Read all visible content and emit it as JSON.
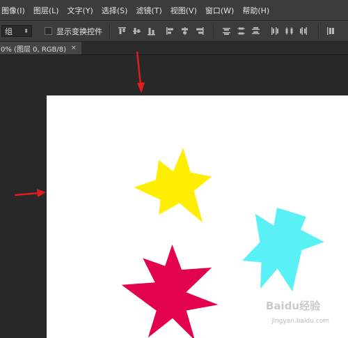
{
  "menubar": {
    "items": [
      "图像(I)",
      "图层(L)",
      "文字(Y)",
      "选择(S)",
      "滤镜(T)",
      "视图(V)",
      "窗口(W)",
      "帮助(H)"
    ]
  },
  "options": {
    "group_select_value": "组",
    "show_transform_label": "显示变换控件"
  },
  "tab": {
    "label": "0% (图层 0, RGB/8)",
    "close": "×"
  },
  "canvas": {
    "background": "#ffffff",
    "shapes": [
      {
        "name": "yellow-star",
        "color": "#ffee00"
      },
      {
        "name": "cyan-star",
        "color": "#59f0f6"
      },
      {
        "name": "crimson-star",
        "color": "#e3024e"
      }
    ]
  },
  "annotations": {
    "arrow_color": "#e11c1c"
  },
  "watermark": {
    "brand": "Baidu经验",
    "url": "jingyan.baidu.com"
  }
}
